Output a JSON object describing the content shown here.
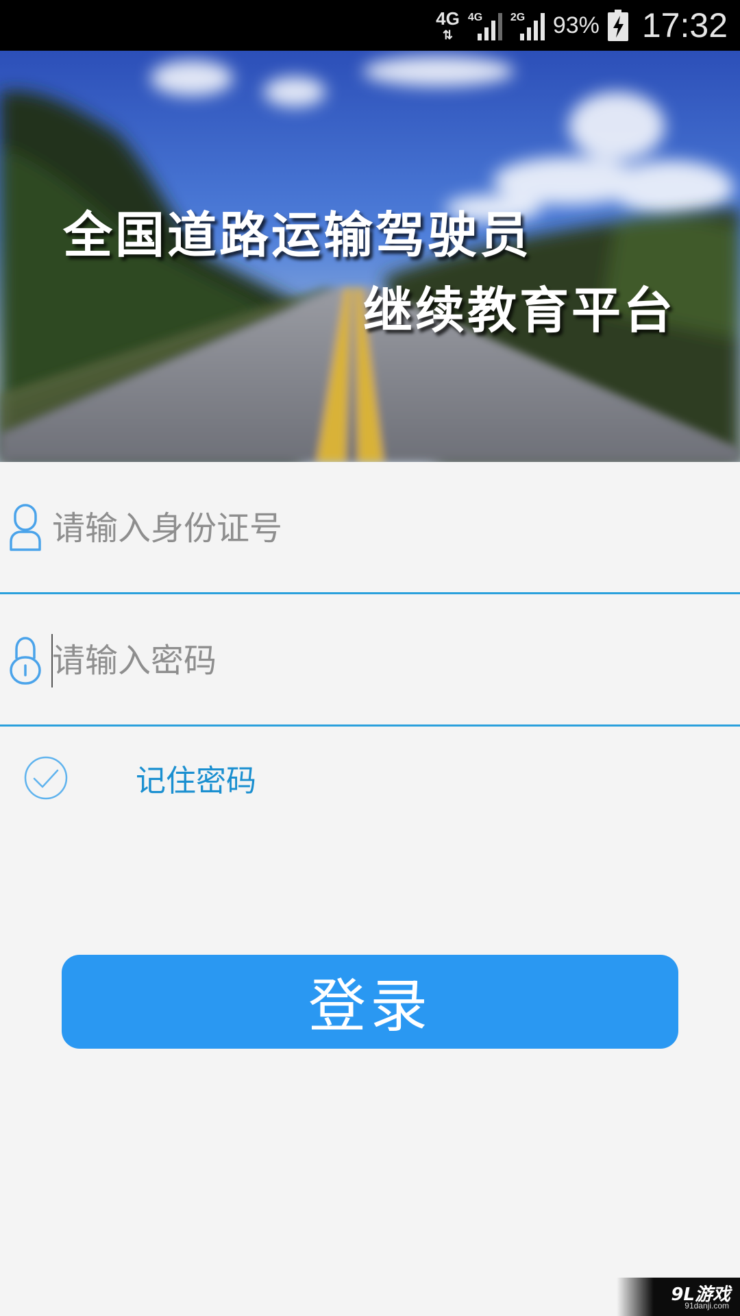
{
  "status_bar": {
    "network_primary": "4G",
    "network_sim1": "4G",
    "network_sim2": "2G",
    "battery_percent": "93%",
    "time": "17:32"
  },
  "banner": {
    "title_line1": "全国道路运输驾驶员",
    "title_line2": "继续教育平台"
  },
  "form": {
    "id_placeholder": "请输入身份证号",
    "id_value": "",
    "password_placeholder": "请输入密码",
    "password_value": "",
    "remember_label": "记住密码",
    "remember_checked": true,
    "login_label": "登录"
  },
  "watermark": {
    "brand": "9L游戏",
    "site": "91danji.com"
  },
  "colors": {
    "accent": "#2aa0dc",
    "button": "#2a98f2",
    "label": "#1a8fd0",
    "background": "#f4f4f4"
  }
}
